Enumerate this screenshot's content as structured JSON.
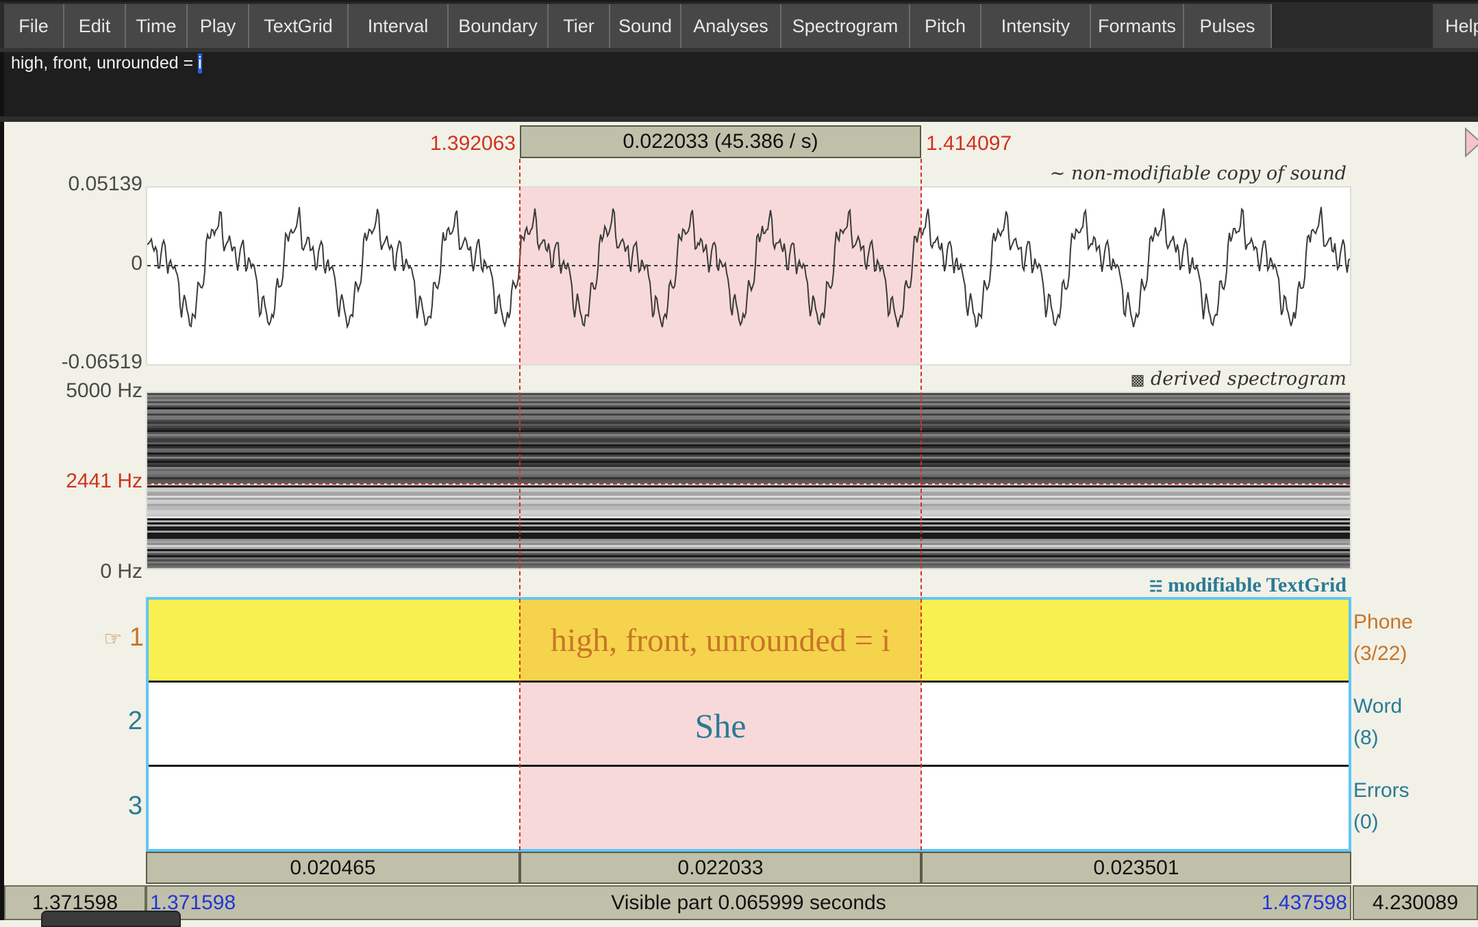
{
  "menu": {
    "items": [
      "File",
      "Edit",
      "Time",
      "Play",
      "TextGrid",
      "Interval",
      "Boundary",
      "Tier",
      "Sound",
      "Analyses",
      "Spectrogram",
      "Pitch",
      "Intensity",
      "Formants",
      "Pulses"
    ],
    "help": "Help"
  },
  "text_field": {
    "value_prefix": "high, front, unrounded = ",
    "value_selected": "i"
  },
  "selection": {
    "start": "1.392063",
    "end": "1.414097",
    "duration_label": "0.022033 (45.386 / s)"
  },
  "waveform": {
    "caption_icon": "tilde-icon",
    "caption_glyph": "~",
    "caption": "non-modifiable copy of sound",
    "y_max": "0.05139",
    "y_zero": "0",
    "y_min": "-0.06519"
  },
  "spectrogram": {
    "caption_icon": "spectrogram-icon",
    "caption_glyph": "▩",
    "caption": "derived spectrogram",
    "f_max": "5000 Hz",
    "f_cursor": "2441 Hz",
    "f_min": "0 Hz"
  },
  "textgrid": {
    "caption_icon": "textgrid-icon",
    "caption_glyph": "☵",
    "caption": "modifiable TextGrid",
    "pointer_glyph": "☞",
    "tiers": [
      {
        "number": "1",
        "name": "Phone",
        "count": "(3/22)",
        "selected_text": "high, front, unrounded = i",
        "color": "#c87528"
      },
      {
        "number": "2",
        "name": "Word",
        "count": "(8)",
        "selected_text": "She",
        "color": "#2a7a96"
      },
      {
        "number": "3",
        "name": "Errors",
        "count": "(0)",
        "selected_text": "",
        "color": "#2a7a96"
      }
    ]
  },
  "durations": {
    "left": "0.020465",
    "selected": "0.022033",
    "right": "0.023501"
  },
  "bottom_bar": {
    "window_start": "1.371598",
    "visible_start": "1.371598",
    "visible_label": "Visible part 0.065999 seconds",
    "visible_end": "1.437598",
    "total_end": "4.230089"
  },
  "colors": {
    "selection_red": "#d0321e",
    "textgrid_border": "#62c6f4",
    "selected_tier_bg": "#f8f050",
    "selected_interval_bg": "#f6d34c",
    "selection_shade": "#f6d3d3",
    "time_blue": "#2035d6"
  }
}
